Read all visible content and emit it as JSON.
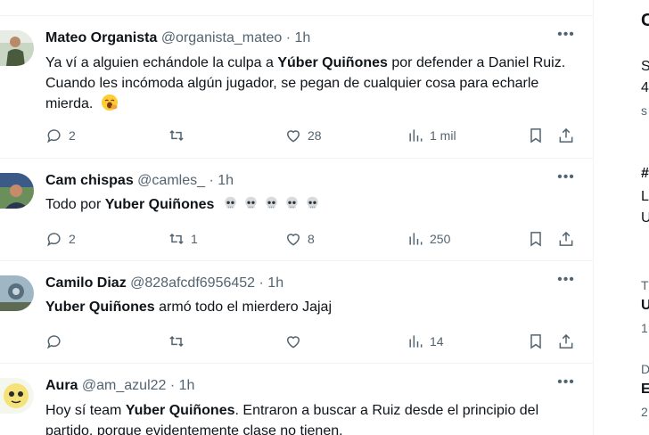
{
  "tweets": [
    {
      "name": "Mateo Organista",
      "handle": "@organista_mateo",
      "dot": "·",
      "time": "1h",
      "text_parts": [
        "Ya ví a alguien echándole la culpa a ",
        "Yúber Quiñones",
        " por defender a Daniel Ruiz. Cuando les incómoda algún jugador, se pegan de cualquier cosa para echarle mierda."
      ],
      "emoji": "yawning-face",
      "replies": "2",
      "retweets": "",
      "likes": "28",
      "views": "1 mil"
    },
    {
      "name": "Cam chispas",
      "handle": "@camles_",
      "dot": "·",
      "time": "1h",
      "text_parts": [
        "Todo por ",
        "Yuber Quiñones",
        ""
      ],
      "emoji": "skull x5",
      "replies": "2",
      "retweets": "1",
      "likes": "8",
      "views": "250"
    },
    {
      "name": "Camilo Diaz",
      "handle": "@828afcdf6956452",
      "dot": "·",
      "time": "1h",
      "text_parts": [
        "",
        "Yuber Quiñones",
        " armó todo el mierdero Jajaj"
      ],
      "replies": "",
      "retweets": "",
      "likes": "",
      "views": "14"
    },
    {
      "name": "Aura",
      "handle": "@am_azul22",
      "dot": "·",
      "time": "1h",
      "text_parts": [
        "Hoy sí team ",
        "Yuber Quiñones",
        ". Entraron a buscar a Ruiz desde el principio del partido, porque evidentemente clase no tienen."
      ]
    }
  ],
  "sidebar_fragments": [
    "C",
    "S",
    "4",
    "s",
    "#",
    "L",
    "U",
    "T",
    "U",
    "1",
    "D",
    "E",
    "2"
  ],
  "icons": {
    "more": "more-horizontal-icon",
    "reply": "reply-icon",
    "retweet": "retweet-icon",
    "like": "heart-icon",
    "views": "views-chart-icon",
    "bookmark": "bookmark-icon",
    "share": "share-icon"
  },
  "colors": {
    "text": "#0f1419",
    "muted": "#536471",
    "border": "#eff3f4"
  }
}
